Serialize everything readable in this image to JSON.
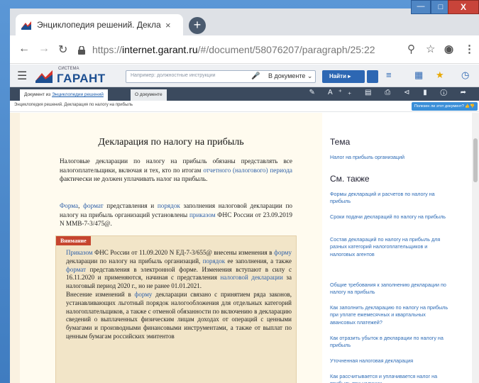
{
  "browser": {
    "tab_title": "Энциклопедия решений. Деклар",
    "tab_close": "×",
    "new_tab": "+",
    "url_prefix": "https://",
    "url_host": "internet.garant.ru",
    "url_path": "/#/document/58076207/paragraph/25:22",
    "window_controls": {
      "minimize": "—",
      "maximize": "□",
      "close": "X"
    }
  },
  "garant": {
    "logo_caption": "СИСТЕМА",
    "logo_text": "ГАРАНТ",
    "search_placeholder": "Например: должностные инструкции",
    "search_scope": "В документе ⌄",
    "find_label": "Найти ▸"
  },
  "doc_tabs": {
    "active_prefix": "Документ из ",
    "active_link": "Энциклопедии решений",
    "second": "О документе"
  },
  "breadcrumb": {
    "text": "Энциклопедия решений. Декларация по налогу на прибыль",
    "help": "Полезен ли этот документ? 👍👎"
  },
  "document": {
    "title": "Декларация по налогу на прибыль",
    "p1_a": "Налоговые декларации по налогу на прибыль обязаны представлять все налогоплательщики, включая и тех, кто по итогам ",
    "p1_link": "отчетного (налогового) периода",
    "p1_b": " фактически не должен уплачивать налог на прибыль.",
    "p2_link1": "Форма",
    "p2_sep": ", ",
    "p2_link2": "формат",
    "p2_a": " представления и ",
    "p2_link3": "порядок",
    "p2_b": " заполнения налоговой декларации по налогу на прибыль организаций установлены ",
    "p2_link4": "приказом",
    "p2_c": " ФНС России от 23.09.2019 N ММВ-7-3/475@.",
    "attention_label": "Внимание",
    "att_link1": "Приказом",
    "att_a": " ФНС России от 11.09.2020 N ЕД-7-3/655@ внесены изменения в ",
    "att_link2": "форму",
    "att_b": " декларации по налогу на прибыль организаций, ",
    "att_link3": "порядок",
    "att_c": " ее заполнения, а также ",
    "att_link4": "формат",
    "att_d": " представления в электронной форме. Изменения вступают в силу с 16.11.2020 и применяются, начиная с представления ",
    "att_link5": "налоговой декларации",
    "att_e": " за налоговый период 2020 г., но не ранее 01.01.2021.",
    "att2_a": "Внесение изменений в ",
    "att2_link": "форму",
    "att2_b": " декларации связано с принятием ряда законов, устанавливающих льготный порядок налогообложения для отдельных категорий налогоплательщиков, а также с отменой обязанности по включению в декларацию сведений о выплаченных физическим лицам доходах от операций с ценными бумагами и производными финансовыми инструментами, а также от выплат по ценным бумагам российских эмитентов"
  },
  "sidebar": {
    "topic_heading": "Тема",
    "topic_link": "Налог на прибыль организаций",
    "see_also_heading": "См. также",
    "links": [
      "Формы деклараций и расчетов по налогу на прибыль",
      "Сроки подачи деклараций по налогу на прибыль",
      "Состав деклараций по налогу на прибыль для разных категорий налогоплательщиков и налоговых агентов",
      "Общие требования к заполнению декларации по налогу на прибыль",
      "Как заполнить декларацию по налогу на прибыль при уплате ежемесячных и квартальных авансовых платежей?",
      "Как отразить убыток в декларации по налогу на прибыль",
      "Уточненная налоговая декларация",
      "Как рассчитывается и уплачивается налог на прибыль при наличии"
    ]
  },
  "colors": {
    "accent": "#2d67b3",
    "link": "#2d6bb5",
    "attention": "#c6452f"
  }
}
